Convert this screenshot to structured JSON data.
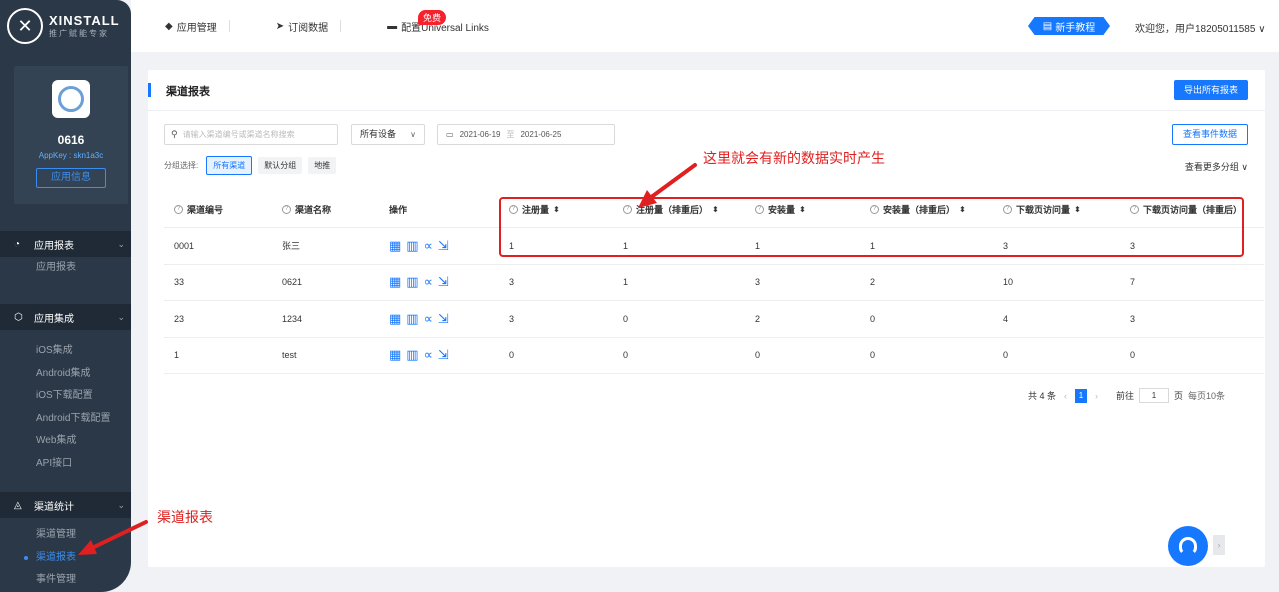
{
  "sidebar": {
    "logo_title": "XINSTALL",
    "logo_sub": "推广赋能专家",
    "app_name": "0616",
    "app_key": "AppKey : skn1a3c",
    "app_info_btn": "应用信息",
    "groups": [
      {
        "label": "应用报表",
        "icon": "chart-icon",
        "items": [
          "应用报表"
        ]
      },
      {
        "label": "应用集成",
        "icon": "cube-icon",
        "items": [
          "iOS集成",
          "Android集成",
          "iOS下载配置",
          "Android下载配置",
          "Web集成",
          "API接口"
        ]
      },
      {
        "label": "渠道统计",
        "icon": "channel-icon",
        "items": [
          "渠道管理",
          "渠道报表",
          "事件管理"
        ],
        "active_item": "渠道报表"
      }
    ]
  },
  "topbar": {
    "nav": [
      "应用管理",
      "订阅数据",
      "配置Universal Links"
    ],
    "free_badge": "免费",
    "guide_btn": "新手教程",
    "welcome": "欢迎您，用户18205011585 ∨"
  },
  "main": {
    "title": "渠道报表",
    "export_btn": "导出所有报表",
    "search_placeholder": "请输入渠道编号或渠道名称搜索",
    "device_select": "所有设备",
    "date_start": "2021-06-19",
    "date_sep": "至",
    "date_end": "2021-06-25",
    "event_btn": "查看事件数据",
    "group_label": "分组选择:",
    "group_tags": [
      "所有渠道",
      "默认分组",
      "地推"
    ],
    "more_groups": "查看更多分组 ∨",
    "annotation": "这里就会有新的数据实时产生",
    "sidebar_annotation": "渠道报表",
    "columns": [
      "渠道编号",
      "渠道名称",
      "操作",
      "注册量",
      "注册量（排重后）",
      "安装量",
      "安装量（排重后）",
      "下载页访问量",
      "下载页访问量（排重后）"
    ],
    "rows": [
      [
        "0001",
        "张三",
        "1",
        "1",
        "1",
        "1",
        "3",
        "3"
      ],
      [
        "33",
        "0621",
        "3",
        "1",
        "3",
        "2",
        "10",
        "7"
      ],
      [
        "23",
        "1234",
        "3",
        "0",
        "2",
        "0",
        "4",
        "3"
      ],
      [
        "1",
        "test",
        "0",
        "0",
        "0",
        "0",
        "0",
        "0"
      ]
    ],
    "pager": {
      "total": "共 4 条",
      "current": "1",
      "goto_label": "前往",
      "goto_value": "1",
      "page_unit": "页",
      "page_size": "每页10条"
    }
  },
  "colors": {
    "primary": "#1677ff",
    "sidebar_bg": "#2b3847",
    "annotation": "#e02020"
  }
}
